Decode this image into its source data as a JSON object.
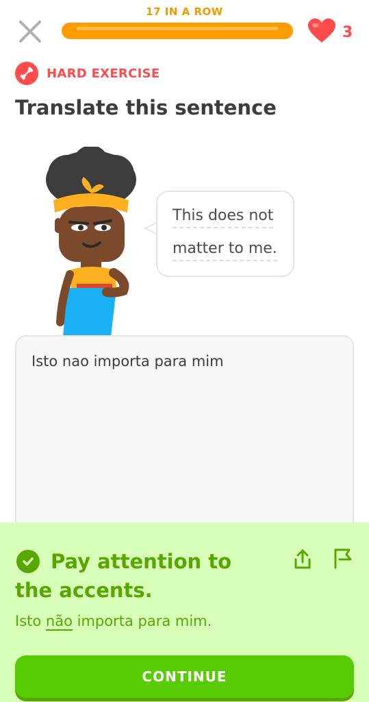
{
  "header": {
    "streak_text": "17 IN A ROW",
    "progress_fraction": 1.0,
    "hearts_count": "3"
  },
  "exercise": {
    "difficulty_label": "HARD EXERCISE",
    "title": "Translate this sentence",
    "prompt_line1": "This does not",
    "prompt_line2": "matter to me.",
    "user_answer": "Isto nao importa para mim"
  },
  "feedback": {
    "title": "Pay attention to the accents.",
    "correct_prefix": "Isto ",
    "correct_highlight": "não",
    "correct_suffix": " importa para mim.",
    "continue_label": "CONTINUE"
  },
  "colors": {
    "streak": "#f29b00",
    "progress": "#ff9d00",
    "heart": "#ff4b4b",
    "feedback_bg": "#d7ffb8",
    "feedback_text": "#58a700",
    "button": "#58cc02"
  },
  "icons": [
    "close-icon",
    "heart-icon",
    "dumbbell-icon",
    "check-icon",
    "share-icon",
    "flag-icon"
  ]
}
